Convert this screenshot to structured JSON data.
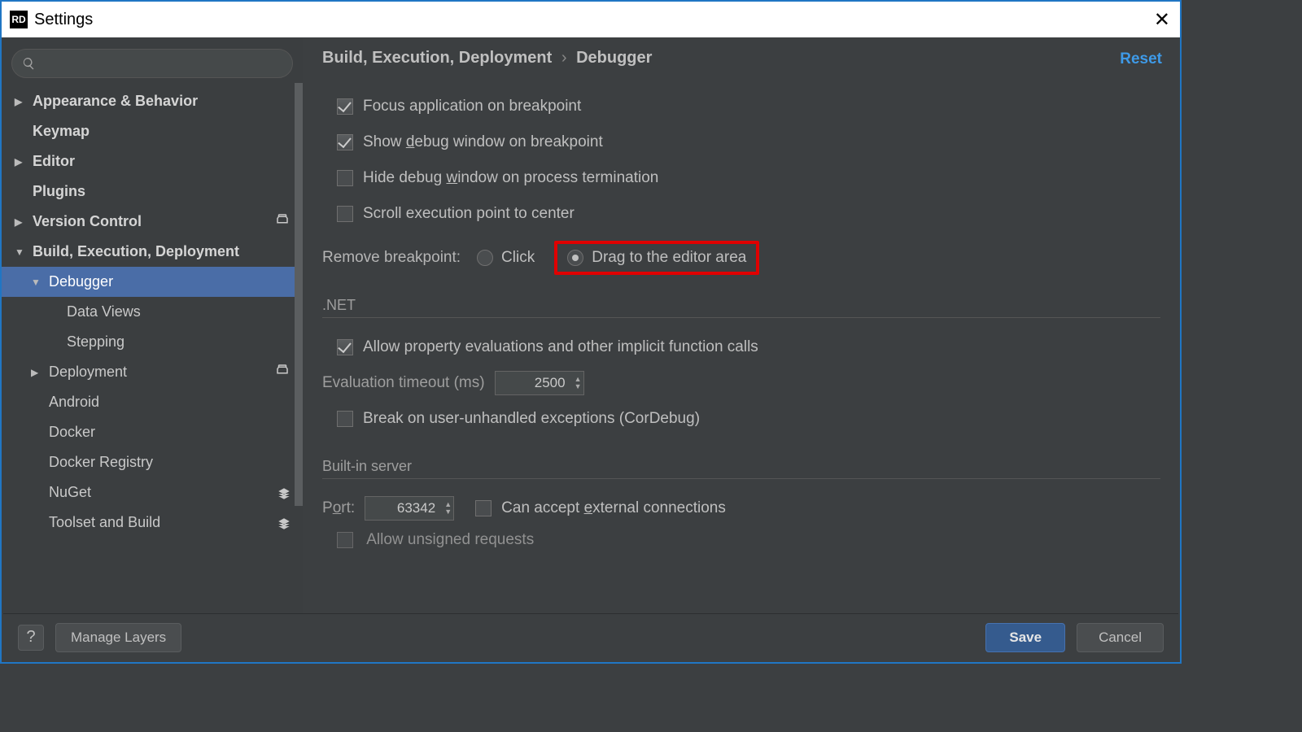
{
  "window": {
    "title": "Settings",
    "icon_label": "RD"
  },
  "sidebar": {
    "search_placeholder": "",
    "items": [
      {
        "label": "Appearance & Behavior",
        "expandable": true,
        "bold": true
      },
      {
        "label": "Keymap",
        "bold": true
      },
      {
        "label": "Editor",
        "expandable": true,
        "bold": true
      },
      {
        "label": "Plugins",
        "bold": true
      },
      {
        "label": "Version Control",
        "expandable": true,
        "bold": true,
        "badge": "project"
      },
      {
        "label": "Build, Execution, Deployment",
        "expandable": true,
        "expanded": true,
        "bold": true
      },
      {
        "label": "Debugger",
        "indent": 1,
        "expanded": true,
        "selected": true
      },
      {
        "label": "Data Views",
        "indent": 2
      },
      {
        "label": "Stepping",
        "indent": 2
      },
      {
        "label": "Deployment",
        "indent": 1,
        "expandable": true,
        "badge": "project"
      },
      {
        "label": "Android",
        "indent": 1
      },
      {
        "label": "Docker",
        "indent": 1
      },
      {
        "label": "Docker Registry",
        "indent": 1
      },
      {
        "label": "NuGet",
        "indent": 1,
        "badge": "layers"
      },
      {
        "label": "Toolset and Build",
        "indent": 1,
        "badge": "layers"
      }
    ]
  },
  "breadcrumb": {
    "parent": "Build, Execution, Deployment",
    "current": "Debugger"
  },
  "reset_label": "Reset",
  "options": {
    "focus_app": {
      "label": "Focus application on breakpoint",
      "checked": true
    },
    "show_debug": {
      "pre": "Show ",
      "ul": "d",
      "post": "ebug window on breakpoint",
      "checked": true
    },
    "hide_debug": {
      "pre": "Hide debug ",
      "ul": "w",
      "post": "indow on process termination",
      "checked": false
    },
    "scroll_center": {
      "label": "Scroll execution point to center",
      "checked": false
    },
    "remove_bp": {
      "label": "Remove breakpoint:",
      "click": "Click",
      "drag": "Drag to the editor area",
      "selected": "drag"
    }
  },
  "section_net": {
    "title": ".NET",
    "allow_prop": {
      "label": "Allow property evaluations and other implicit function calls",
      "checked": true
    },
    "eval_timeout": {
      "label": "Evaluation timeout (ms)",
      "value": "2500"
    },
    "break_unhandled": {
      "label": "Break on user-unhandled exceptions (CorDebug)",
      "checked": false
    }
  },
  "section_server": {
    "title": "Built-in server",
    "port": {
      "pre": "P",
      "ul": "o",
      "post": "rt:",
      "value": "63342"
    },
    "accept_ext": {
      "pre": "Can accept ",
      "ul": "e",
      "post": "xternal connections",
      "checked": false
    },
    "allow_unsigned": {
      "label": "Allow unsigned requests"
    }
  },
  "footer": {
    "help": "?",
    "manage_layers": "Manage Layers",
    "save": "Save",
    "cancel": "Cancel"
  }
}
